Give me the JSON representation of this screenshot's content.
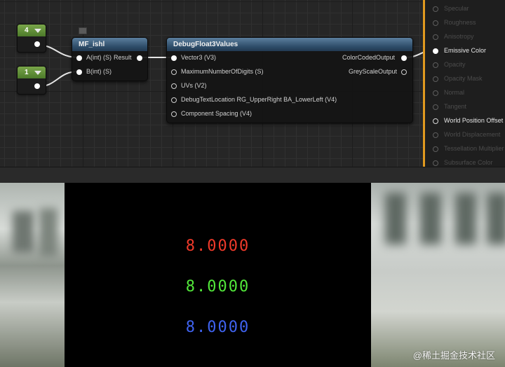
{
  "constants": [
    {
      "value": "4"
    },
    {
      "value": "1"
    }
  ],
  "mf_node": {
    "title": "MF_ishl",
    "inputs": [
      "A(int) (S)",
      "B(int) (S)"
    ],
    "output": "Result"
  },
  "debug_node": {
    "title": "DebugFloat3Values",
    "inputs": [
      "Vector3 (V3)",
      "MaximumNumberOfDigits (S)",
      "UVs (V2)",
      "DebugTextLocation RG_UpperRight BA_LowerLeft (V4)",
      "Component Spacing (V4)"
    ],
    "outputs": [
      "ColorCodedOutput",
      "GreyScaleOutput"
    ]
  },
  "material_pins": [
    {
      "label": "Specular",
      "active": false
    },
    {
      "label": "Roughness",
      "active": false
    },
    {
      "label": "Anisotropy",
      "active": false
    },
    {
      "label": "Emissive Color",
      "active": true
    },
    {
      "label": "Opacity",
      "active": false
    },
    {
      "label": "Opacity Mask",
      "active": false
    },
    {
      "label": "Normal",
      "active": false
    },
    {
      "label": "Tangent",
      "active": false
    },
    {
      "label": "World Position Offset",
      "active": true
    },
    {
      "label": "World Displacement",
      "active": false
    },
    {
      "label": "Tessellation Multiplier",
      "active": false
    },
    {
      "label": "Subsurface Color",
      "active": false
    }
  ],
  "preview_values": [
    {
      "text": "8.0000",
      "color": "#f03a2a"
    },
    {
      "text": "8.0000",
      "color": "#52e83a"
    },
    {
      "text": "8.0000",
      "color": "#3f63f0"
    }
  ],
  "watermark": "@稀土掘金技术社区",
  "colors": {
    "graph_bg": "#262626",
    "node_header": "#3d5f80",
    "constant_header": "#5e8e36",
    "material_border": "#e19a1f"
  }
}
